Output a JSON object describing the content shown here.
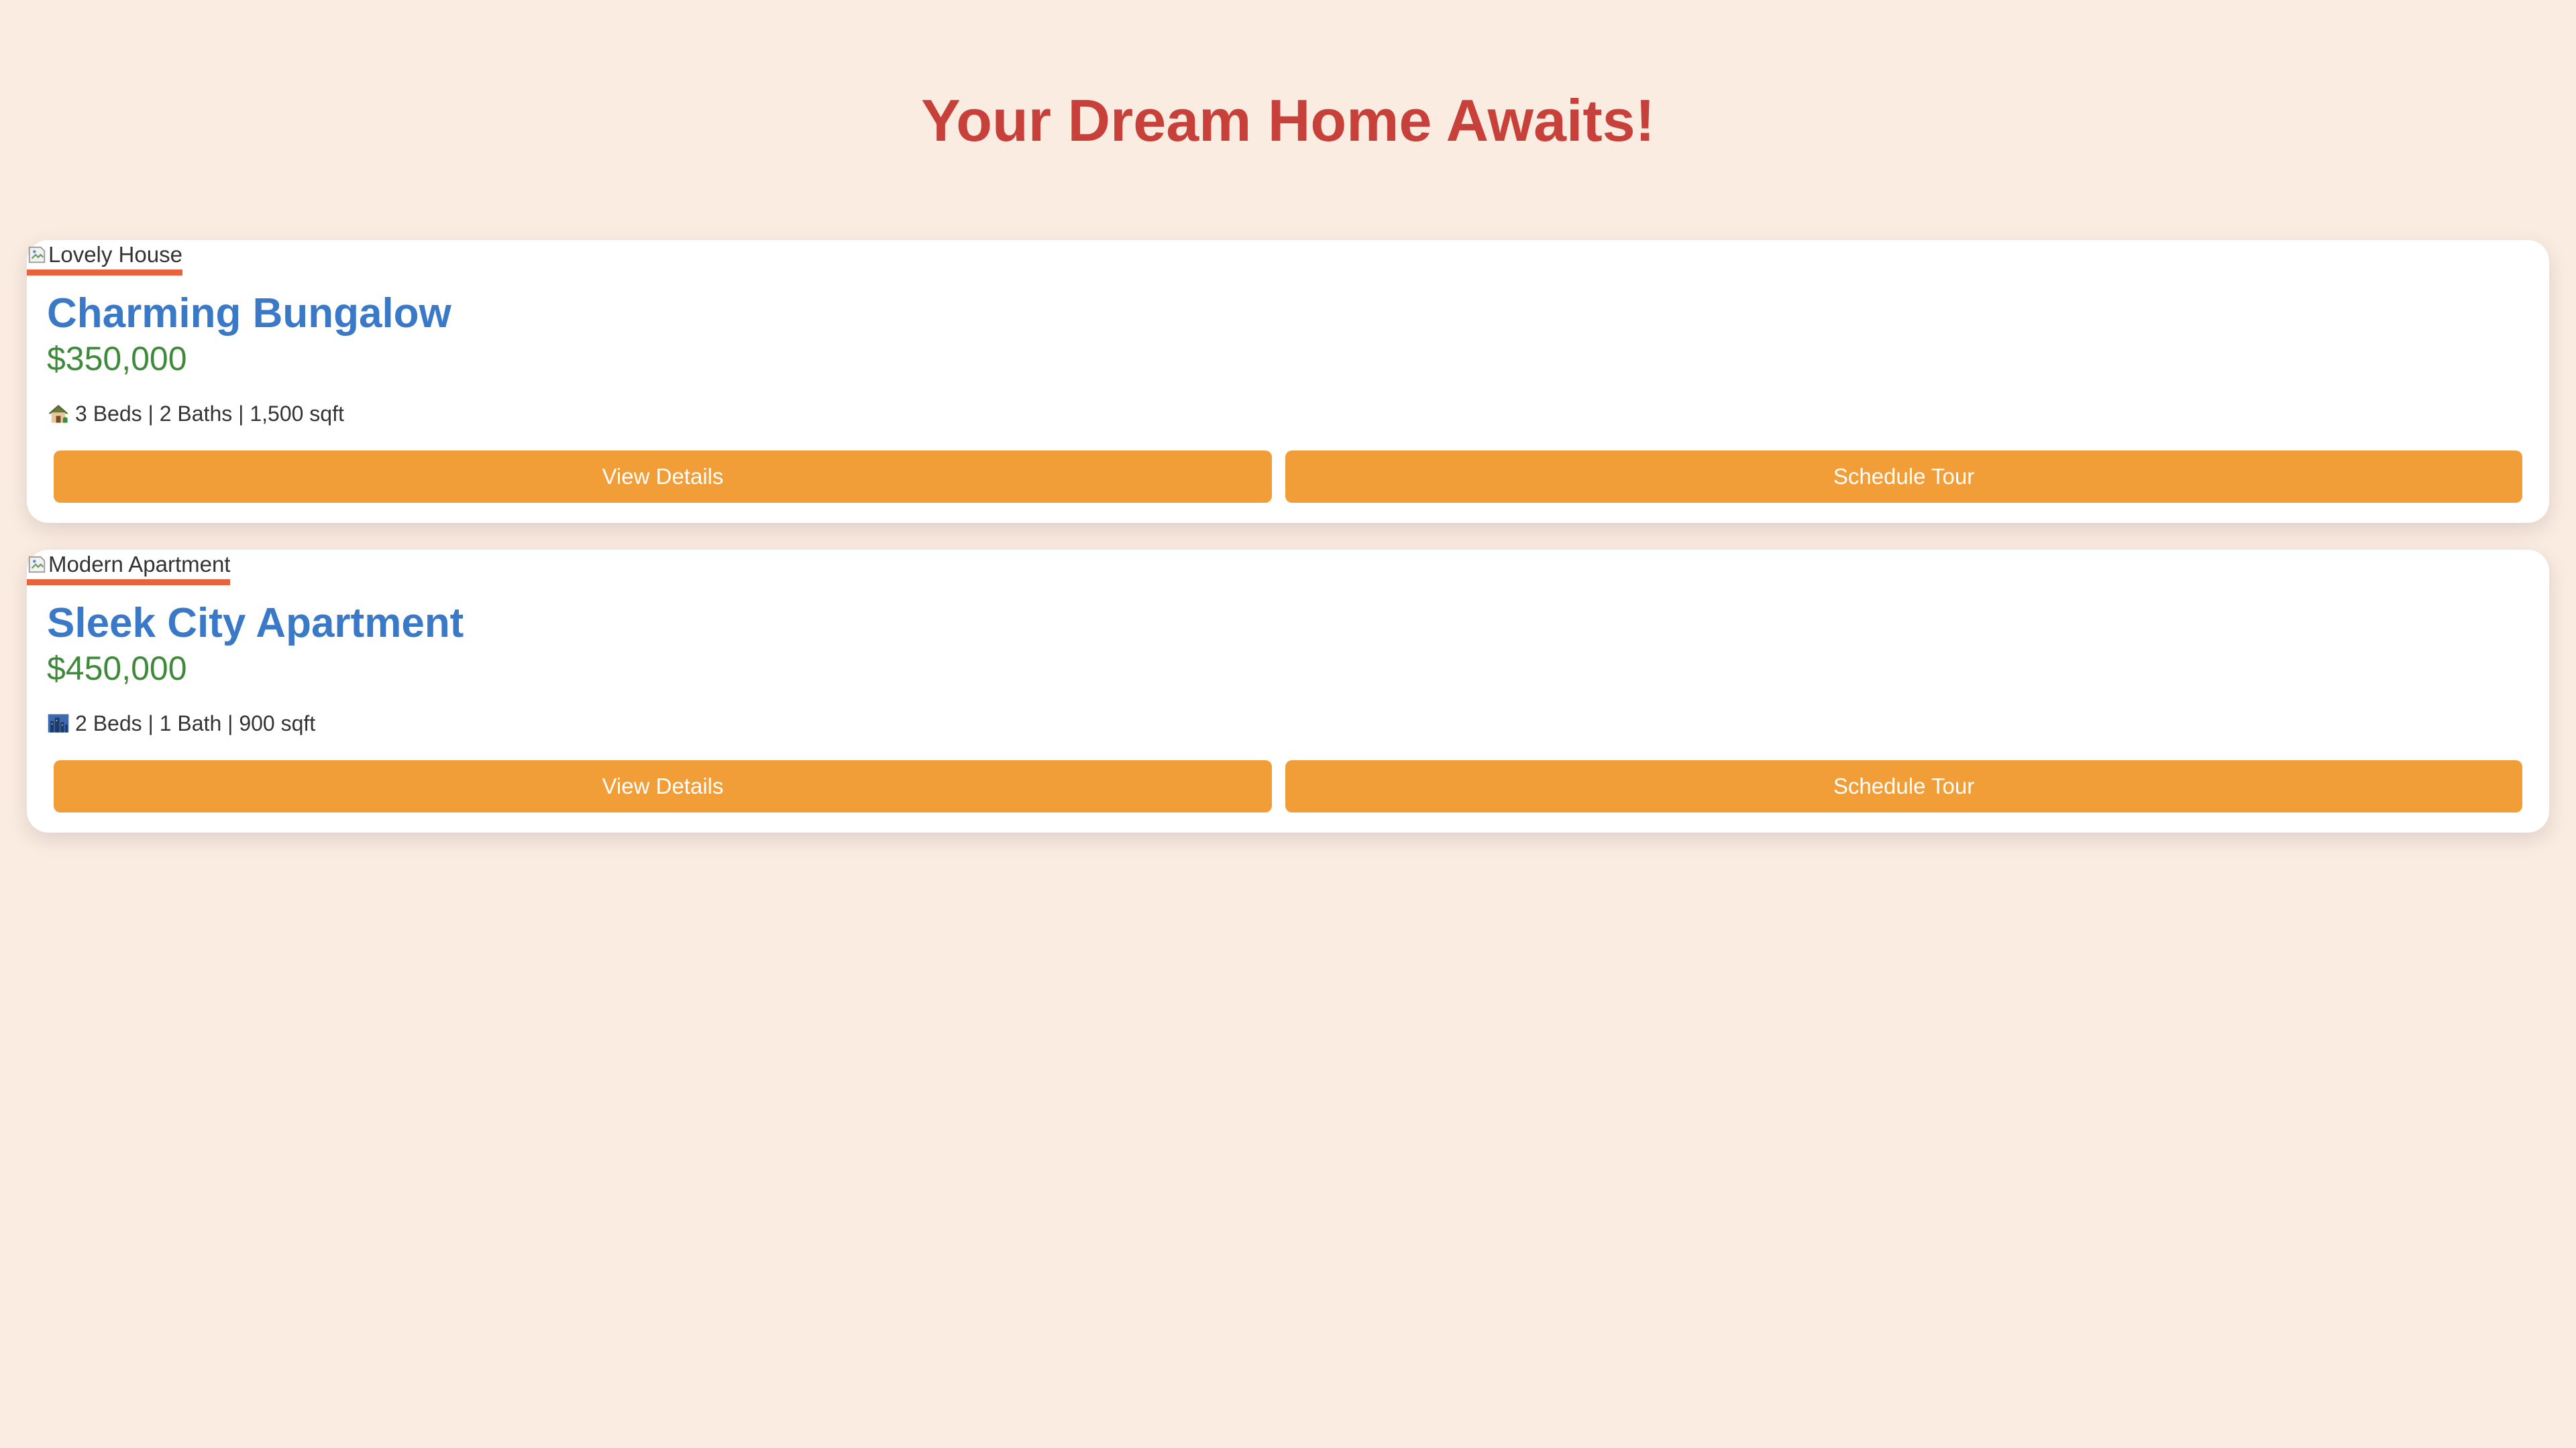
{
  "page": {
    "title": "Your Dream Home Awaits!"
  },
  "listings": [
    {
      "image_alt": "Lovely House",
      "feature_icon": "house-icon",
      "title": "Charming Bungalow",
      "price": "$350,000",
      "features": "3 Beds | 2 Baths | 1,500 sqft",
      "view_details_label": "View Details",
      "schedule_tour_label": "Schedule Tour"
    },
    {
      "image_alt": "Modern Apartment",
      "feature_icon": "city-icon",
      "title": "Sleek City Apartment",
      "price": "$450,000",
      "features": "2 Beds | 1 Bath | 900 sqft",
      "view_details_label": "View Details",
      "schedule_tour_label": "Schedule Tour"
    }
  ],
  "colors": {
    "background": "#fbece2",
    "title": "#c8403a",
    "listing_title": "#3a78c8",
    "price": "#3e8a3a",
    "button": "#f29e38",
    "image_underline": "#e8623b"
  }
}
